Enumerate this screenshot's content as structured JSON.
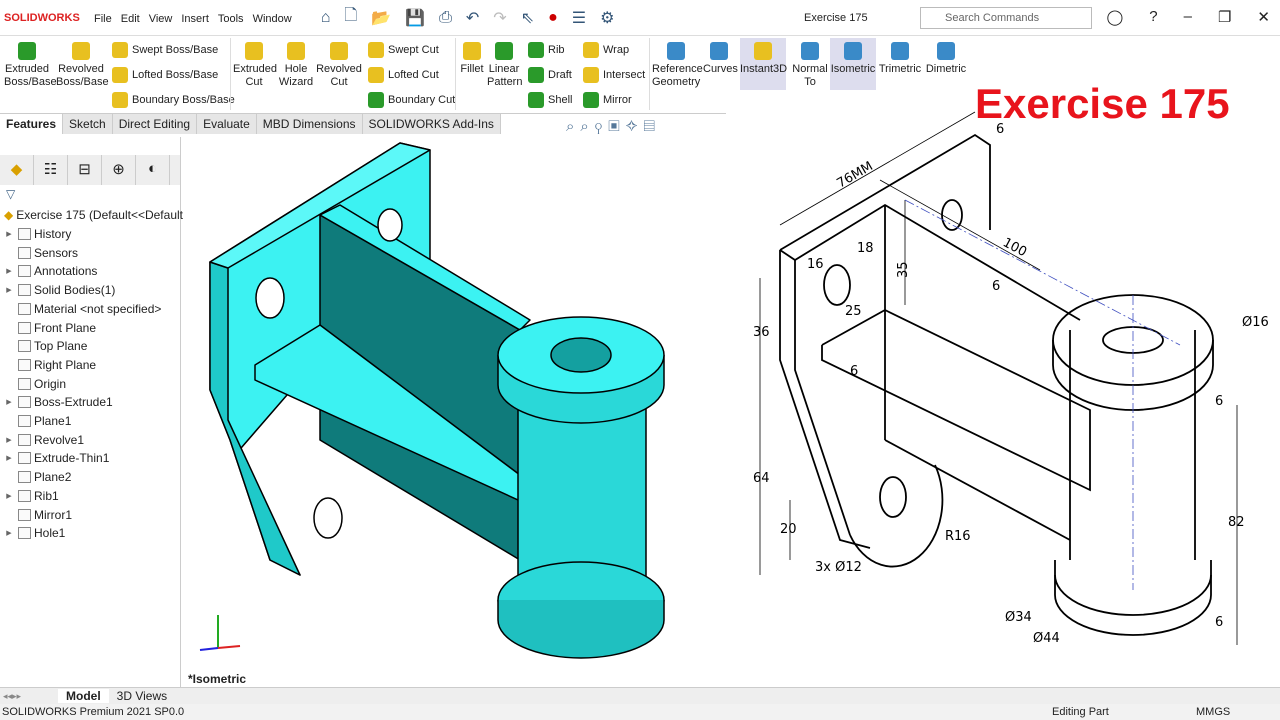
{
  "app": {
    "logo": "SOLIDWORKS",
    "title": "Exercise 175",
    "search_placeholder": "Search Commands"
  },
  "menu": [
    "File",
    "Edit",
    "View",
    "Insert",
    "Tools",
    "Window"
  ],
  "ribbon": {
    "extruded_boss": "Extruded Boss/Base",
    "revolved_boss": "Revolved Boss/Base",
    "swept_boss": "Swept Boss/Base",
    "lofted_boss": "Lofted Boss/Base",
    "boundary_boss": "Boundary Boss/Base",
    "extruded_cut": "Extruded Cut",
    "hole_wizard": "Hole Wizard",
    "revolved_cut": "Revolved Cut",
    "swept_cut": "Swept Cut",
    "lofted_cut": "Lofted Cut",
    "boundary_cut": "Boundary Cut",
    "fillet": "Fillet",
    "linear_pattern": "Linear Pattern",
    "rib": "Rib",
    "draft": "Draft",
    "shell": "Shell",
    "wrap": "Wrap",
    "intersect": "Intersect",
    "mirror": "Mirror",
    "reference_geometry": "Reference Geometry",
    "curves": "Curves",
    "instant3d": "Instant3D",
    "normal_to": "Normal To",
    "isometric": "Isometric",
    "trimetric": "Trimetric",
    "dimetric": "Dimetric"
  },
  "tabs": [
    "Features",
    "Sketch",
    "Direct Editing",
    "Evaluate",
    "MBD Dimensions",
    "SOLIDWORKS Add-Ins"
  ],
  "tree": {
    "root": "Exercise 175  (Default<<Default",
    "items": [
      {
        "label": "History",
        "expand": true
      },
      {
        "label": "Sensors",
        "expand": false
      },
      {
        "label": "Annotations",
        "expand": true
      },
      {
        "label": "Solid Bodies(1)",
        "expand": true
      },
      {
        "label": "Material <not specified>",
        "expand": false
      },
      {
        "label": "Front Plane",
        "expand": false
      },
      {
        "label": "Top Plane",
        "expand": false
      },
      {
        "label": "Right Plane",
        "expand": false
      },
      {
        "label": "Origin",
        "expand": false
      },
      {
        "label": "Boss-Extrude1",
        "expand": true
      },
      {
        "label": "Plane1",
        "expand": false
      },
      {
        "label": "Revolve1",
        "expand": true
      },
      {
        "label": "Extrude-Thin1",
        "expand": true
      },
      {
        "label": "Plane2",
        "expand": false
      },
      {
        "label": "Rib1",
        "expand": true
      },
      {
        "label": "Mirror1",
        "expand": false
      },
      {
        "label": "Hole1",
        "expand": true
      }
    ]
  },
  "viewport": {
    "view_label": "*Isometric",
    "model_color": "#33f0f0"
  },
  "exercise_title": "Exercise 175",
  "dimensions": {
    "d76": "76MM",
    "d6a": "6",
    "d100": "100",
    "d6b": "6",
    "d16": "16",
    "d18": "18",
    "d35": "35",
    "d25": "25",
    "d36": "36",
    "d6c": "6",
    "d64": "64",
    "d20": "20",
    "holes": "3x Ø12",
    "r16": "R16",
    "dia16": "Ø16",
    "d6d": "6",
    "d82": "82",
    "dia34": "Ø34",
    "dia44": "Ø44",
    "d6e": "6"
  },
  "bottom_tabs": [
    "Model",
    "3D Views"
  ],
  "status": {
    "version": "SOLIDWORKS Premium 2021 SP0.0",
    "mode": "Editing Part",
    "units": "MMGS"
  }
}
